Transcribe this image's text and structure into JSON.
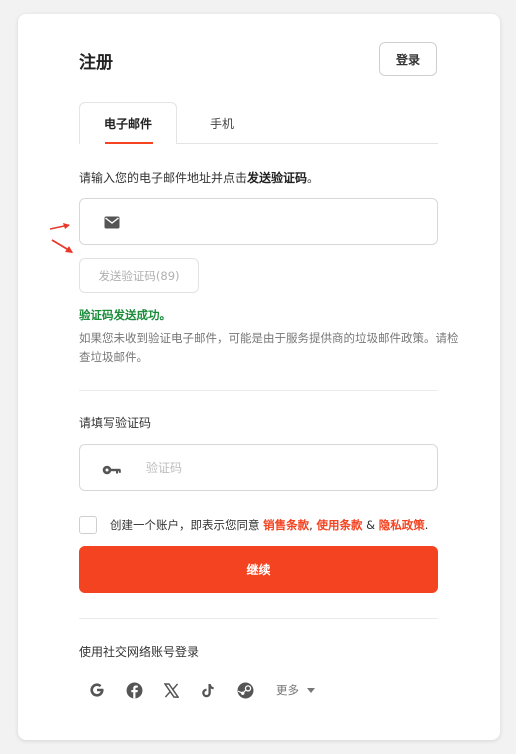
{
  "header": {
    "title": "注册",
    "login_label": "登录"
  },
  "tabs": [
    {
      "label": "电子邮件",
      "active": true
    },
    {
      "label": "手机",
      "active": false
    }
  ],
  "email_step": {
    "prompt_prefix": "请输入您的电子邮件地址并点击",
    "prompt_bold": "发送验证码",
    "prompt_suffix": "。",
    "email_value": "",
    "send_button_label": "发送验证码(89)",
    "success_message": "验证码发送成功。",
    "hint": "如果您未收到验证电子邮件，可能是由于服务提供商的垃圾邮件政策。请检查垃圾邮件。"
  },
  "code_step": {
    "label": "请填写验证码",
    "placeholder": "验证码"
  },
  "terms": {
    "prefix": "创建一个账户，即表示您同意 ",
    "sales_terms": "销售条款",
    "sep1": ", ",
    "use_terms": "使用条款",
    "sep2": " & ",
    "privacy": "隐私政策",
    "suffix": ".",
    "checked": false
  },
  "continue_label": "继续",
  "social": {
    "label": "使用社交网络账号登录",
    "providers": [
      "google-icon",
      "facebook-icon",
      "x-icon",
      "tiktok-icon",
      "steam-icon"
    ],
    "more_label": "更多"
  },
  "colors": {
    "accent": "#f44321",
    "success": "#1a8c3a"
  }
}
